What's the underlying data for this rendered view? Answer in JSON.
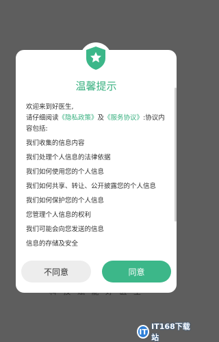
{
  "background": {
    "tagline": "科 技 赋 能 好 医 生"
  },
  "watermark": {
    "logo_letter": "IT",
    "text": "IT168下载站"
  },
  "dialog": {
    "title": "温馨提示",
    "accent_color": "#37b07f",
    "badge_icon": "shield-star-icon",
    "greeting": "欢迎来到好医生,",
    "intro_prefix": "请仔细阅读",
    "privacy_link": "《隐私政策》",
    "intro_and": "及",
    "service_link": "《服务协议》",
    "intro_suffix": ":协议内容包括:",
    "items": [
      "我们收集的信息内容",
      "我们处理个人信息的法律依据",
      "我们如何使用您的个人信息",
      "我们如何共享、转让、公开披露您的个人信息",
      "我们如何保护您的个人信息",
      "您管理个人信息的权利",
      "我们可能会向您发送的信息",
      "信息的存储及安全"
    ]
  },
  "buttons": {
    "disagree": "不同意",
    "agree": "同意"
  }
}
